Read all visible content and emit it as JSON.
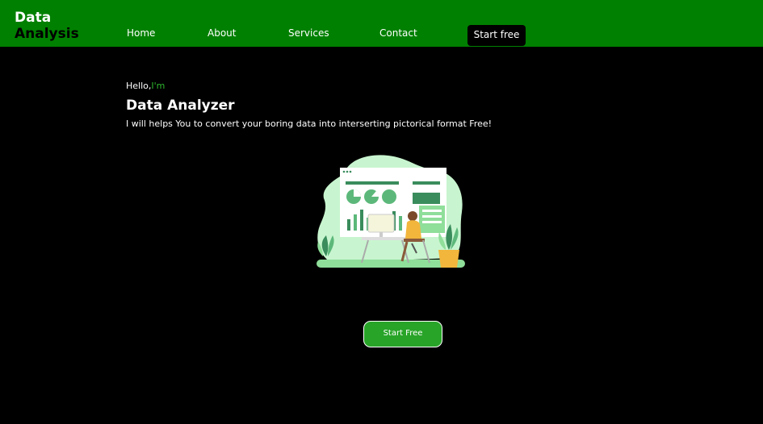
{
  "navbar": {
    "logo_line1": "Data",
    "logo_line2": "Analysis",
    "links": [
      "Home",
      "About",
      "Services",
      "Contact"
    ],
    "cta_label": "Start free",
    "background": "#008000"
  },
  "hero": {
    "greeting": "Hello,",
    "greeting_accent": "I'm",
    "title": "Data Analyzer",
    "description": "I will helps You to convert your boring data into interserting pictorical format Free!",
    "accent_color": "#2eb82e"
  },
  "illustration": {
    "subject": "data-analyst-illustration"
  },
  "cta": {
    "label": "Start Free",
    "color": "#28a428"
  }
}
